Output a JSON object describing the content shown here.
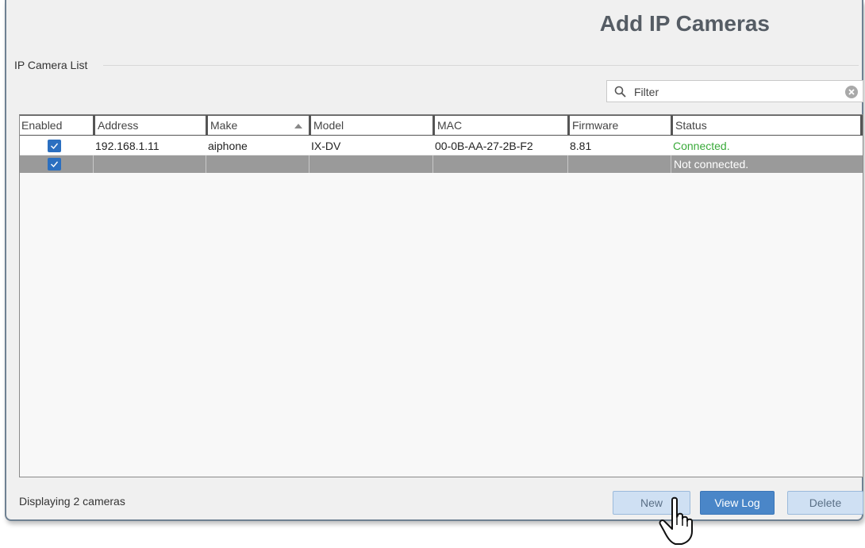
{
  "header": {
    "title": "Add IP Cameras"
  },
  "group": {
    "label": "IP Camera List"
  },
  "filter": {
    "placeholder": "Filter"
  },
  "table": {
    "columns": [
      "Enabled",
      "Address",
      "Make",
      "Model",
      "MAC",
      "Firmware",
      "Status"
    ],
    "sorted_column": "Make",
    "rows": [
      {
        "enabled": true,
        "address": "192.168.1.11",
        "make": "aiphone",
        "model": "IX-DV",
        "mac": "00-0B-AA-27-2B-F2",
        "firmware": "8.81",
        "status": "Connected."
      },
      {
        "enabled": true,
        "address": "",
        "make": "",
        "model": "",
        "mac": "",
        "firmware": "",
        "status": "Not connected."
      }
    ]
  },
  "footer": {
    "count_text": "Displaying 2 cameras"
  },
  "buttons": {
    "new": "New",
    "view_log": "View Log",
    "delete": "Delete"
  },
  "colors": {
    "accent": "#2b6fc0",
    "connected": "#3aaa3a",
    "selected_row": "#9a9a9a",
    "primary_button": "#4a86c8"
  },
  "icons": {
    "filter": "search-icon",
    "clear": "clear-icon",
    "checkbox": "checkmark-icon",
    "cursor": "hand-pointer-icon"
  }
}
